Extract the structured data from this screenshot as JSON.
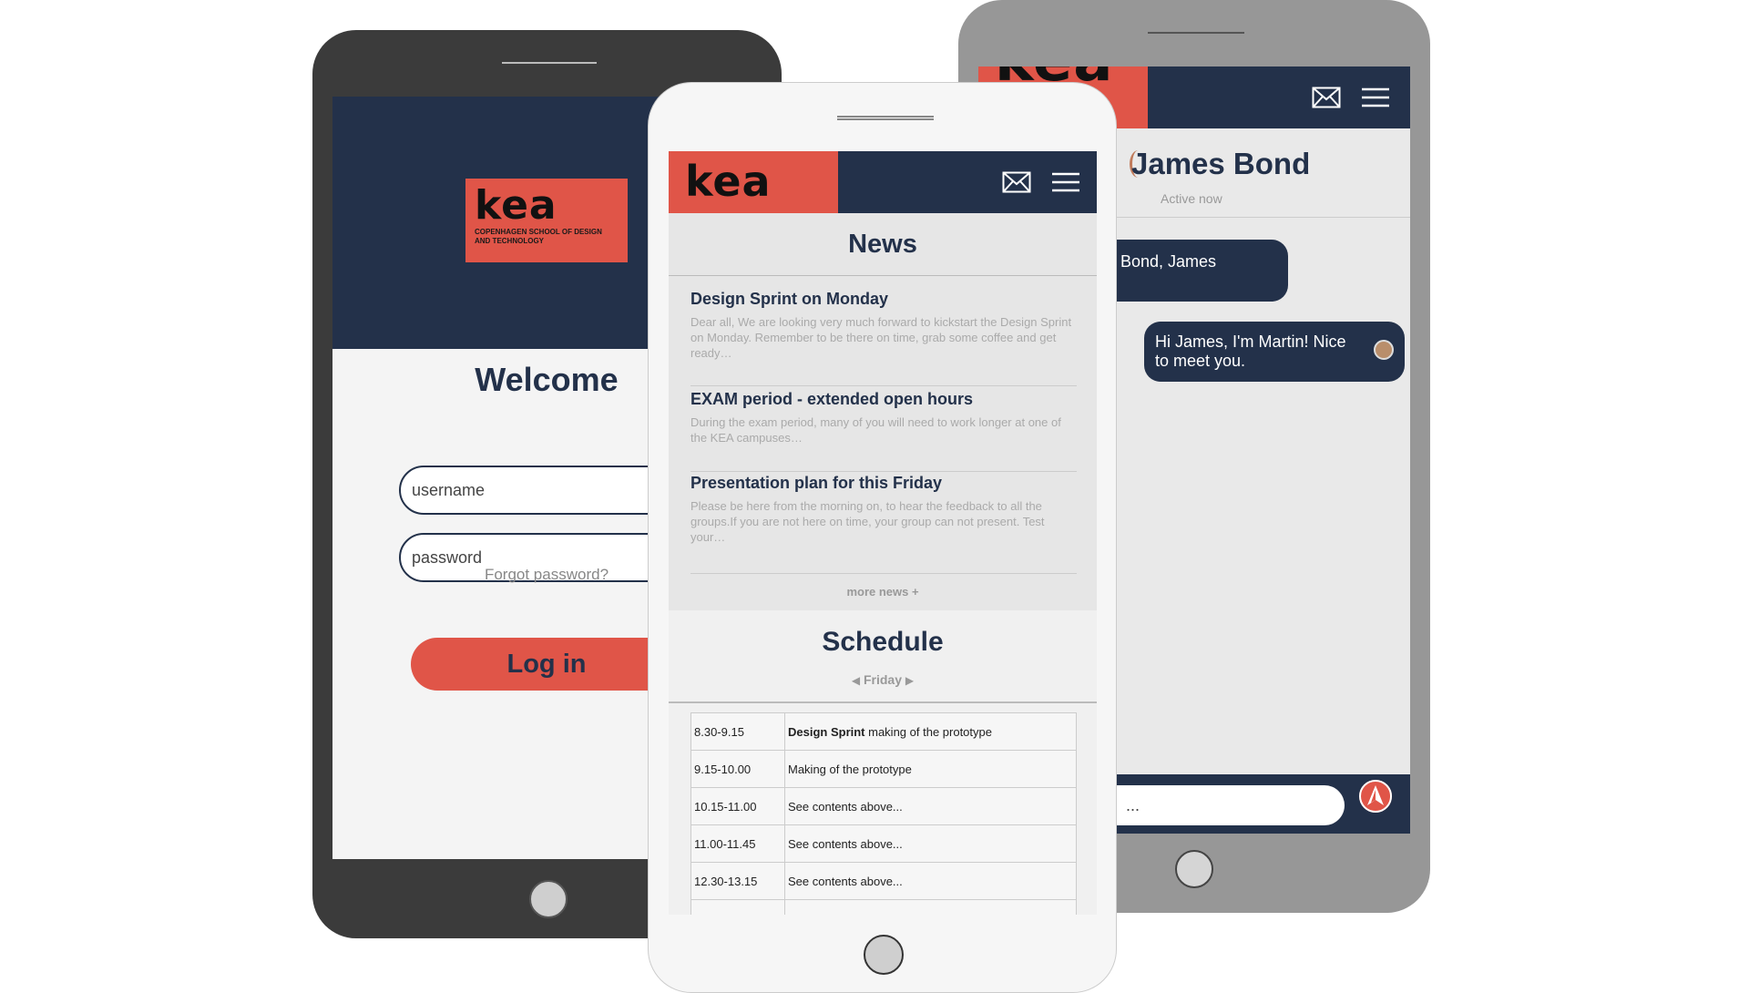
{
  "login_phone": {
    "logo_text": "kea",
    "logo_subtitle": "COPENHAGEN SCHOOL OF DESIGN AND TECHNOLOGY",
    "heading": "Welcome",
    "username_placeholder": "username",
    "password_placeholder": "password",
    "forgot_label": "Forgot password?",
    "login_label": "Log in"
  },
  "news_phone": {
    "logo_text": "kea",
    "news_heading": "News",
    "news": [
      {
        "title": "Design Sprint on Monday",
        "excerpt": "Dear all, We are looking very much forward to kickstart the Design Sprint on Monday. Remember to be there on time, grab some coffee and get ready…"
      },
      {
        "title": "EXAM period - extended open hours",
        "excerpt": "During the exam period, many of you will need to work longer at one of the KEA campuses…"
      },
      {
        "title": "Presentation plan for this Friday",
        "excerpt": "Please be here from the morning on, to hear the feedback to all the groups.If you are not here on time, your group can not present. Test your…"
      }
    ],
    "more_news_label": "more news +",
    "schedule_heading": "Schedule",
    "schedule_day": "Friday",
    "schedule": [
      {
        "time": "8.30-9.15",
        "bold": "Design Sprint",
        "text": " making of the prototype"
      },
      {
        "time": "9.15-10.00",
        "bold": "",
        "text": "Making of the prototype"
      },
      {
        "time": "10.15-11.00",
        "bold": "",
        "text": "See contents above..."
      },
      {
        "time": "11.00-11.45",
        "bold": "",
        "text": "See contents above..."
      },
      {
        "time": "12.30-13.15",
        "bold": "",
        "text": "See contents above..."
      },
      {
        "time": "",
        "bold": "",
        "text": ""
      }
    ]
  },
  "chat_phone": {
    "contact_name": "James Bond",
    "status": "Active now",
    "incoming_message": "me is Bond, James",
    "outgoing_message": "Hi James, I'm Martin! Nice to meet you.",
    "message_placeholder": "..."
  },
  "colors": {
    "navy": "#23314a",
    "kea_red": "#e05548",
    "dark_frame": "#3b3b3b",
    "grey_frame": "#979797",
    "light_frame": "#f6f6f6"
  },
  "icons": [
    "mail-icon",
    "hamburger-menu-icon",
    "send-icon",
    "avatar-icon"
  ]
}
